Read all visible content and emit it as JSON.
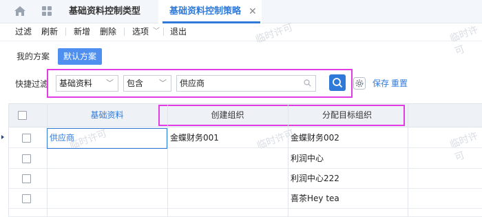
{
  "tabs": [
    {
      "label": "基础资料控制类型"
    },
    {
      "label": "基础资料控制策略",
      "active": true
    }
  ],
  "toolbar": {
    "filter": "过滤",
    "refresh": "刷新",
    "new": "新增",
    "delete": "删除",
    "options": "选项",
    "exit": "退出"
  },
  "scheme": {
    "label": "我的方案",
    "default_button": "默认方案"
  },
  "quick_filter": {
    "label": "快捷过滤",
    "field": "基础资料",
    "operator": "包含",
    "value": "供应商",
    "save": "保存",
    "reset": "重置"
  },
  "grid": {
    "columns": [
      "基础资料",
      "创建组织",
      "分配目标组织"
    ],
    "rows": [
      {
        "c1": "供应商",
        "c2": "金蝶财务001",
        "c3": "金蝶财务002"
      },
      {
        "c1": "",
        "c2": "",
        "c3": "利润中心"
      },
      {
        "c1": "",
        "c2": "",
        "c3": "利润中心222"
      },
      {
        "c1": "",
        "c2": "",
        "c3": "喜茶Hey tea"
      }
    ]
  },
  "watermark": "临时许可",
  "colors": {
    "accent": "#2f7ad9",
    "highlight": "#e33be3",
    "tab_bar": "#f3f6fa"
  }
}
